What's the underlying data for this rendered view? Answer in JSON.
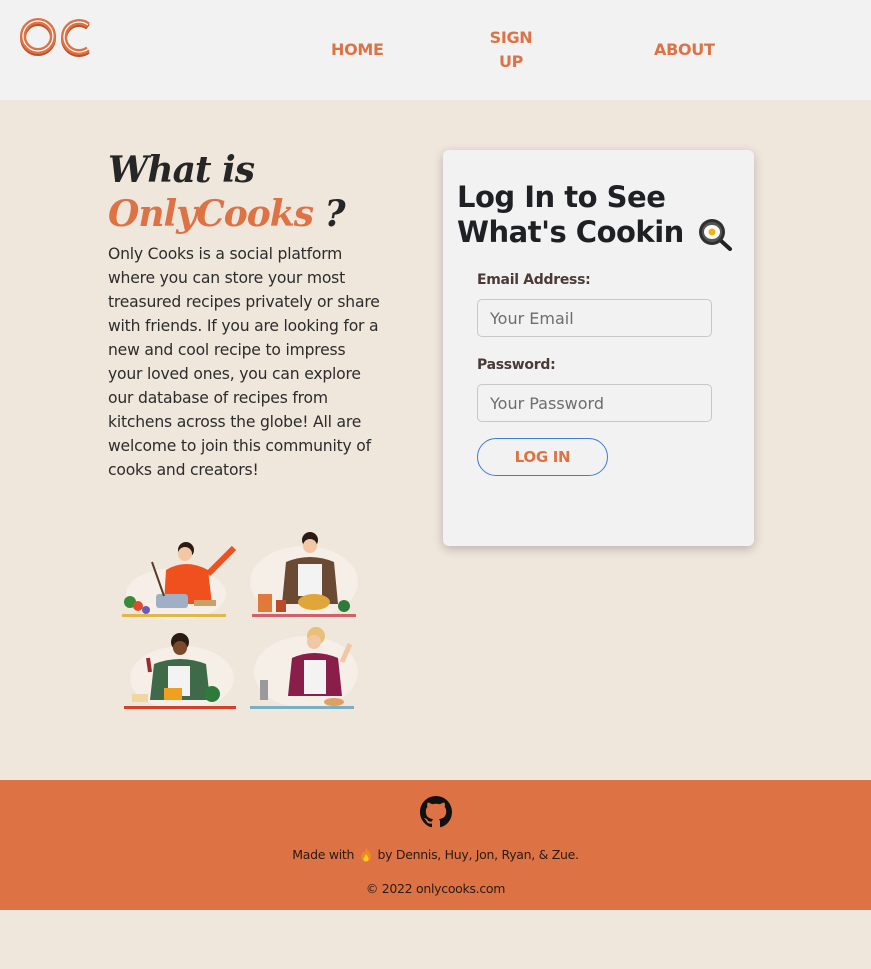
{
  "nav": {
    "logo_text": "OC",
    "links": [
      {
        "label": "HOME"
      },
      {
        "label": "SIGN UP"
      },
      {
        "label": "ABOUT"
      }
    ]
  },
  "intro": {
    "title_prefix": "What is",
    "title_brand": "OnlyCooks",
    "title_suffix": " ?",
    "description": "Only Cooks is a social platform where you can store your most treasured recipes privately or share with friends. If you are looking for a new and cool recipe to impress your loved ones, you can explore our database of recipes from kitchens across the globe! All are welcome to join this community of cooks and creators!"
  },
  "login": {
    "title": "Log In to See What's Cookin",
    "title_icon": "frying-pan-egg-icon",
    "email_label": "Email Address:",
    "email_placeholder": "Your Email",
    "email_value": "",
    "password_label": "Password:",
    "password_placeholder": "Your Password",
    "password_value": "",
    "submit_label": "LOG IN"
  },
  "footer": {
    "icon": "github-icon",
    "made_prefix": "Made with",
    "made_icon": "fire-icon",
    "made_suffix": "by Dennis, Huy, Jon, Ryan, & Zue.",
    "copyright": "© 2022 onlycooks.com"
  },
  "colors": {
    "accent": "#dd7345",
    "background": "#efe6dc",
    "nav_bg": "#f2f2f2",
    "button_border": "#3f7bd8"
  }
}
